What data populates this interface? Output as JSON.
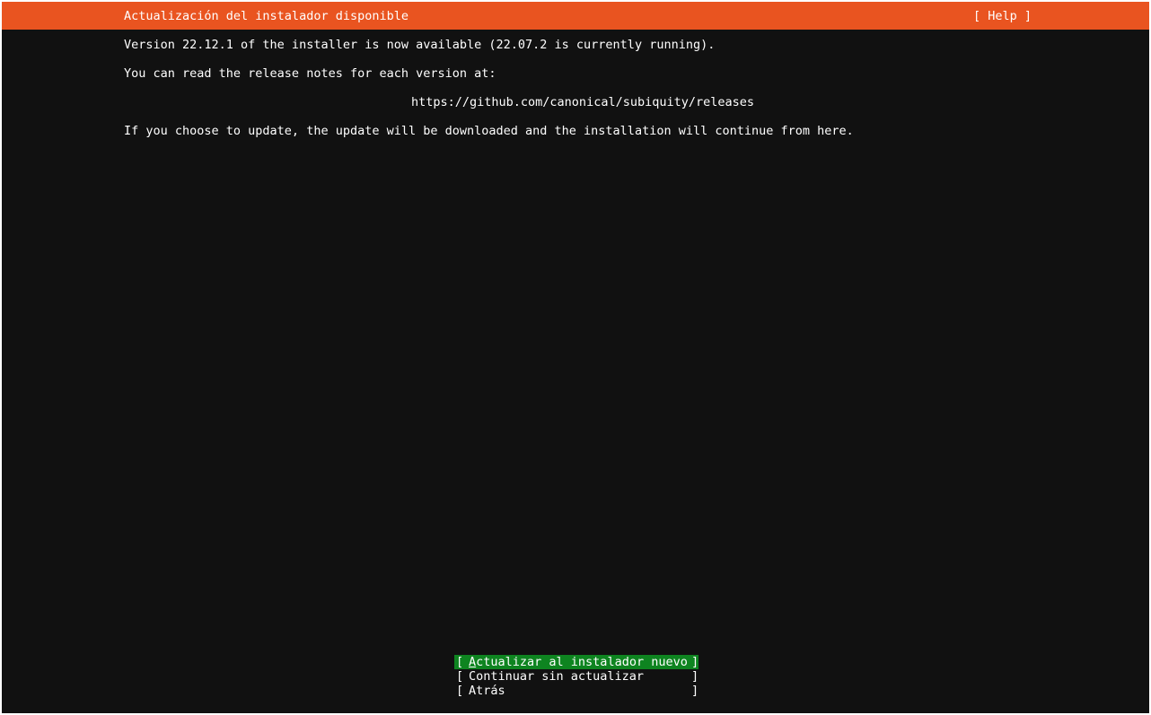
{
  "header": {
    "title": "Actualización del instalador disponible",
    "help": "[ Help ]"
  },
  "body": {
    "line1": "Version 22.12.1 of the installer is now available (22.07.2 is currently running).",
    "line2": "You can read the release notes for each version at:",
    "url": "https://github.com/canonical/subiquity/releases",
    "line3": "If you choose to update, the update will be downloaded and the installation will continue from here."
  },
  "buttons": {
    "update_first": "A",
    "update_rest": "ctualizar al instalador nuevo",
    "continue": "Continuar sin actualizar",
    "back": "Atrás",
    "open_bracket": "[",
    "close_bracket": "]"
  },
  "colors": {
    "header_bg": "#e95420",
    "focus_bg": "#0e8420",
    "screen_bg": "#111111"
  }
}
